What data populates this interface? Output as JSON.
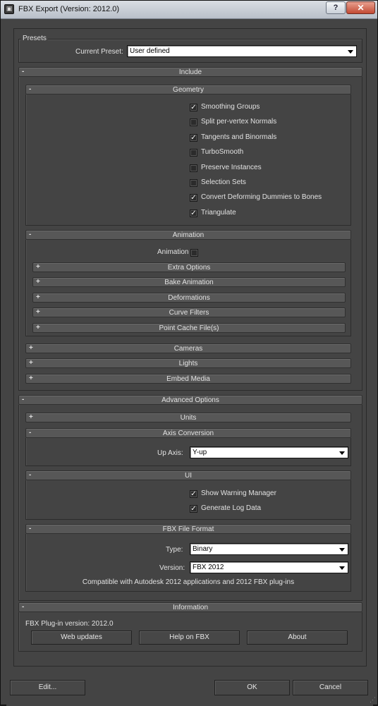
{
  "window": {
    "title": "FBX Export (Version: 2012.0)",
    "help_label": "?",
    "close_label": "✕"
  },
  "presets": {
    "label": "Presets",
    "current_label": "Current Preset:",
    "current_value": "User defined"
  },
  "include": {
    "title": "Include",
    "sign": "-",
    "geometry": {
      "title": "Geometry",
      "sign": "-",
      "items": [
        {
          "label": "Smoothing Groups",
          "checked": true,
          "mark": "✓"
        },
        {
          "label": "Split per-vertex Normals",
          "checked": false,
          "mark": ""
        },
        {
          "label": "Tangents and Binormals",
          "checked": true,
          "mark": "✓"
        },
        {
          "label": "TurboSmooth",
          "checked": false,
          "mark": ""
        },
        {
          "label": "Preserve Instances",
          "checked": false,
          "mark": ""
        },
        {
          "label": "Selection Sets",
          "checked": false,
          "mark": ""
        },
        {
          "label": "Convert Deforming Dummies to Bones",
          "checked": true,
          "mark": "✓"
        },
        {
          "label": "Triangulate",
          "checked": true,
          "mark": "✓"
        }
      ]
    },
    "animation": {
      "title": "Animation",
      "sign": "-",
      "animation_label": "Animation",
      "animation_checked": false,
      "sub_rollouts": [
        {
          "title": "Extra Options",
          "sign": "+"
        },
        {
          "title": "Bake Animation",
          "sign": "+"
        },
        {
          "title": "Deformations",
          "sign": "+"
        },
        {
          "title": "Curve Filters",
          "sign": "+"
        },
        {
          "title": "Point Cache File(s)",
          "sign": "+"
        }
      ]
    },
    "collapsed": [
      {
        "title": "Cameras",
        "sign": "+"
      },
      {
        "title": "Lights",
        "sign": "+"
      },
      {
        "title": "Embed Media",
        "sign": "+"
      }
    ]
  },
  "advanced": {
    "title": "Advanced Options",
    "sign": "-",
    "units": {
      "title": "Units",
      "sign": "+"
    },
    "axis": {
      "title": "Axis Conversion",
      "sign": "-",
      "up_axis_label": "Up Axis:",
      "up_axis_value": "Y-up"
    },
    "ui": {
      "title": "UI",
      "sign": "-",
      "items": [
        {
          "label": "Show Warning Manager",
          "checked": true,
          "mark": "✓"
        },
        {
          "label": "Generate Log Data",
          "checked": true,
          "mark": "✓"
        }
      ]
    },
    "fbx_format": {
      "title": "FBX File Format",
      "sign": "-",
      "type_label": "Type:",
      "type_value": "Binary",
      "version_label": "Version:",
      "version_value": "FBX 2012",
      "compat_text": "Compatible with Autodesk 2012 applications and 2012 FBX plug-ins"
    }
  },
  "information": {
    "title": "Information",
    "sign": "-",
    "plugin_version": "FBX Plug-in version: 2012.0",
    "buttons": [
      "Web updates",
      "Help on FBX",
      "About"
    ]
  },
  "footer": {
    "edit_label": "Edit...",
    "ok_label": "OK",
    "cancel_label": "Cancel"
  },
  "colors": {
    "panel": "#444444",
    "rollout_header": "#575757",
    "title_bar": "#c9d0da",
    "close": "#c24a34"
  }
}
